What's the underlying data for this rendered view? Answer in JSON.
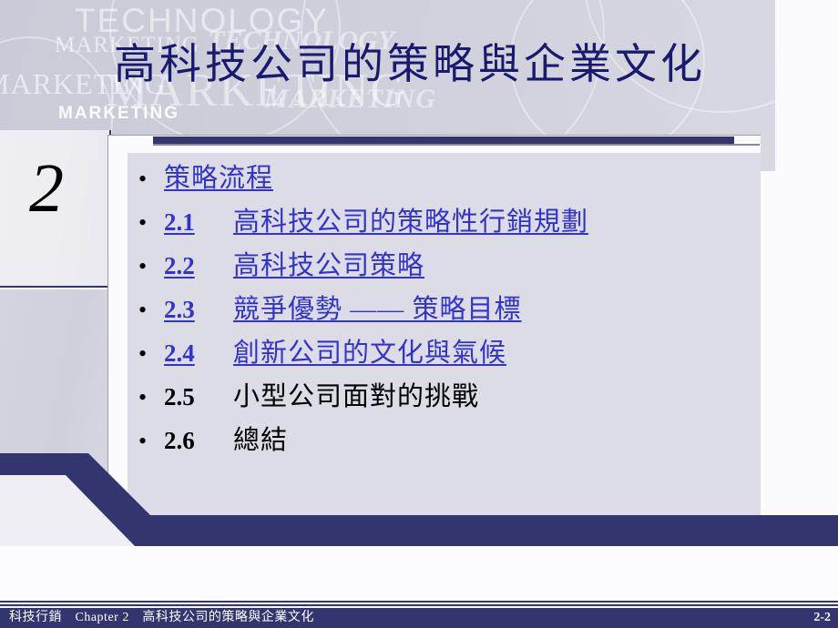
{
  "slide": {
    "title": "高科技公司的策略與企業文化",
    "chapter_number": "2",
    "colors": {
      "navy": "#32356e",
      "title_navy": "#191970",
      "link_blue": "#3333cc",
      "content_bg": "#dcdce6",
      "header_bg": "#ccced9"
    }
  },
  "watermark": {
    "w1": "TECHNOLOGY",
    "w2": "TECHNOLOGY",
    "w3": "MARKETING",
    "w4": "MARKETING",
    "w5": "MARKETING",
    "w6": "MARKETING",
    "w7": "MARKETING"
  },
  "outline": {
    "bullet_glyph": "•",
    "items": [
      {
        "num": "",
        "text": "策略流程",
        "is_link": true,
        "num_link": false
      },
      {
        "num": "2.1",
        "text": "高科技公司的策略性行銷規劃",
        "is_link": true,
        "num_link": true
      },
      {
        "num": "2.2",
        "text": "高科技公司策略",
        "is_link": true,
        "num_link": true
      },
      {
        "num": "2.3",
        "text": "競爭優勢 —— 策略目標",
        "is_link": true,
        "num_link": true
      },
      {
        "num": "2.4",
        "text": "創新公司的文化與氣候",
        "is_link": true,
        "num_link": true
      },
      {
        "num": "2.5",
        "text": "小型公司面對的挑戰",
        "is_link": false,
        "num_link": false
      },
      {
        "num": "2.6",
        "text": "總結",
        "is_link": false,
        "num_link": false
      }
    ]
  },
  "footer": {
    "left_text": "科技行銷　Chapter 2　高科技公司的策略與企業文化",
    "page_label": "2-2"
  }
}
